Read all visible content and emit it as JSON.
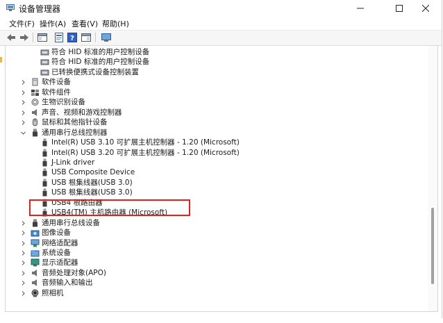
{
  "window": {
    "title": "设备管理器",
    "controls": [
      "minimize",
      "maximize",
      "close"
    ]
  },
  "menu": [
    "文件(F)",
    "操作(A)",
    "查看(V)",
    "帮助(H)"
  ],
  "toolbar": {
    "buttons": [
      "back-icon",
      "forward-icon",
      "properties-icon",
      "help-icon",
      "show-hide-icon",
      "print-icon",
      "computer-monitor-icon"
    ]
  },
  "tree": {
    "items": [
      {
        "label": "符合 HID 标准的用户控制设备",
        "icon": "hid-device-icon",
        "expanded": null
      },
      {
        "label": "符合 HID 标准的用户控制设备",
        "icon": "hid-device-icon",
        "expanded": null
      },
      {
        "label": "已转换便携式设备控制装置",
        "icon": "hid-device-icon",
        "expanded": null
      },
      {
        "label": "软件设备",
        "icon": "software-device-icon",
        "expanded": false
      },
      {
        "label": "软件组件",
        "icon": "software-component-icon",
        "expanded": false
      },
      {
        "label": "生物识别设备",
        "icon": "biometric-icon",
        "expanded": false
      },
      {
        "label": "声音、视频和游戏控制器",
        "icon": "speaker-icon",
        "expanded": false
      },
      {
        "label": "鼠标和其他指针设备",
        "icon": "mouse-icon",
        "expanded": false
      },
      {
        "label": "通用串行总线控制器",
        "icon": "usb-icon",
        "expanded": true
      },
      {
        "label": "Intel(R) USB 3.10 可扩展主机控制器 - 1.20 (Microsoft)",
        "icon": "usb-plug-icon",
        "expanded": null
      },
      {
        "label": "Intel(R) USB 3.20 可扩展主机控制器 - 1.20 (Microsoft)",
        "icon": "usb-plug-icon",
        "expanded": null
      },
      {
        "label": "J-Link driver",
        "icon": "usb-plug-icon",
        "expanded": null
      },
      {
        "label": "USB Composite Device",
        "icon": "usb-plug-icon",
        "expanded": null
      },
      {
        "label": "USB 根集线器(USB 3.0)",
        "icon": "usb-plug-icon",
        "expanded": null
      },
      {
        "label": "USB 根集线器(USB 3.0)",
        "icon": "usb-plug-icon",
        "expanded": null
      },
      {
        "label": "USB4 根路由器",
        "icon": "usb-plug-icon",
        "expanded": null
      },
      {
        "label": "USB4(TM) 主机路由器 (Microsoft)",
        "icon": "usb-plug-icon",
        "expanded": null
      },
      {
        "label": "通用串行总线设备",
        "icon": "usb-icon",
        "expanded": false
      },
      {
        "label": "图像设备",
        "icon": "camera-icon",
        "expanded": false
      },
      {
        "label": "网络适配器",
        "icon": "network-icon",
        "expanded": false
      },
      {
        "label": "系统设备",
        "icon": "folder-icon",
        "expanded": false
      },
      {
        "label": "显示适配器",
        "icon": "display-icon",
        "expanded": false
      },
      {
        "label": "音频处理对象(APO)",
        "icon": "speaker-icon",
        "expanded": false
      },
      {
        "label": "音频输入和输出",
        "icon": "speaker-icon",
        "expanded": false
      },
      {
        "label": "照相机",
        "icon": "webcam-icon",
        "expanded": false
      }
    ],
    "highlighted_item": "J-Link driver"
  },
  "colors": {
    "highlight_border": "#e0201c",
    "toolbar_bg": "#f6f6f6",
    "scroll_thumb": "#a0a0a0"
  }
}
